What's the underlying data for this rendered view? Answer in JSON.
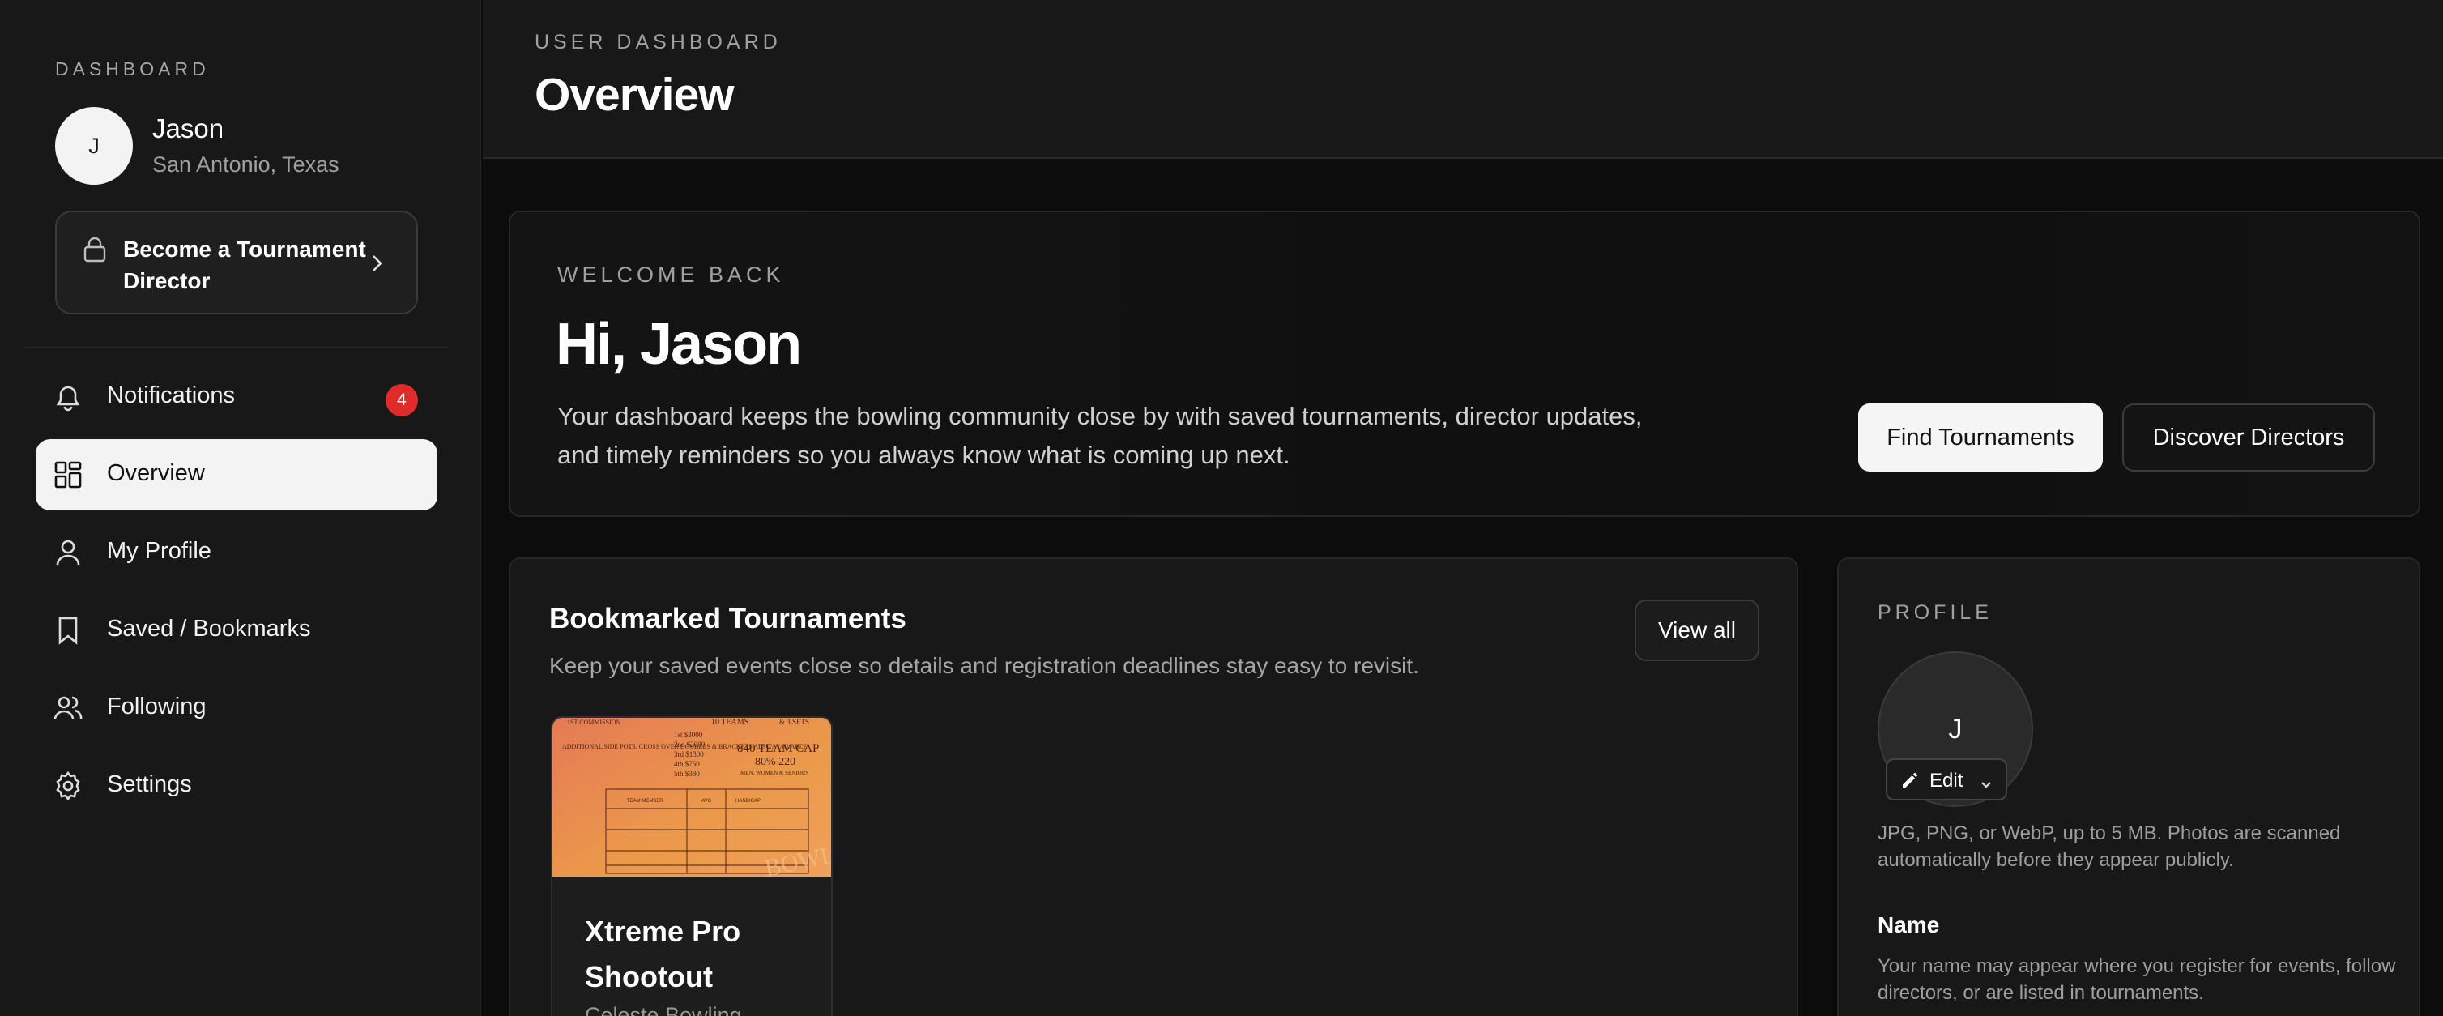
{
  "sidebar": {
    "label": "DASHBOARD",
    "user": {
      "initial": "J",
      "name": "Jason",
      "location": "San Antonio, Texas"
    },
    "director_cta": "Become a Tournament Director",
    "nav": [
      {
        "label": "Notifications",
        "icon": "bell-icon",
        "badge": "4"
      },
      {
        "label": "Overview",
        "icon": "dashboard-grid-icon",
        "active": true
      },
      {
        "label": "My Profile",
        "icon": "user-icon"
      },
      {
        "label": "Saved / Bookmarks",
        "icon": "bookmark-icon"
      },
      {
        "label": "Following",
        "icon": "users-icon"
      },
      {
        "label": "Settings",
        "icon": "gear-icon"
      }
    ]
  },
  "header": {
    "eyebrow": "USER DASHBOARD",
    "title": "Overview"
  },
  "welcome": {
    "eyebrow": "WELCOME BACK",
    "greeting": "Hi, Jason",
    "description": "Your dashboard keeps the bowling community close by with saved tournaments, director updates, and timely reminders so you always know what is coming up next.",
    "primary_button": "Find Tournaments",
    "secondary_button": "Discover Directors"
  },
  "bookmarks": {
    "title": "Bookmarked Tournaments",
    "subtitle": "Keep your saved events close so details and registration deadlines stay easy to revisit.",
    "view_all": "View all",
    "items": [
      {
        "name": "Xtreme Pro Shootout",
        "venue": "Celeste Bowling",
        "thumbnail": {
          "top_left": "1ST COMMISSION",
          "top_mid": "10 TEAMS",
          "top_right": "& 3 SETS",
          "side_note": "ADDITIONAL SIDE POTS, CROSS OVER DOUBLES & BRACKETS ALSO AVAILABLE",
          "payouts": [
            "1st $3000",
            "2nd $2000",
            "3rd $1300",
            "4th $760",
            "5th $380"
          ],
          "cap": "840 TEAM CAP",
          "handicap": "80% 220",
          "mix": "MEN, WOMEN & SENIORS",
          "table_headers": [
            "TEAM MEMBER",
            "AVG",
            "HANDICAP"
          ],
          "watermark": "BOWL"
        }
      }
    ]
  },
  "profile": {
    "eyebrow": "PROFILE",
    "initial": "J",
    "edit_label": "Edit",
    "photo_hint": "JPG, PNG, or WebP, up to 5 MB. Photos are scanned automatically before they appear publicly.",
    "name_label": "Name",
    "name_hint": "Your name may appear where you register for events, follow directors, or are listed in tournaments."
  },
  "colors": {
    "background": "#0c0c0c",
    "panel": "#181818",
    "active_nav": "#f3f3f3",
    "badge": "#e02b2b",
    "thumbnail_orange": "#e8914a"
  }
}
